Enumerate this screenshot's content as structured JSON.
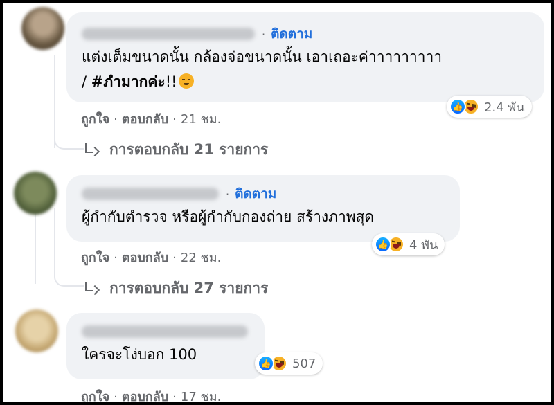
{
  "comments": [
    {
      "follow_label": "ติดตาม",
      "text_line1": "แต่งเต็มขนาดนั้น กล้องจ่อขนาดนั้น เอาเถอะค่าาาาาาาาา",
      "text_line2_prefix": "/ ",
      "text_line2_bold": "#ภำมากค่ะ",
      "text_line2_suffix": "!!",
      "emoji": "pensive-face",
      "reaction_count": "2.4 พัน",
      "like_label": "ถูกใจ",
      "reply_label": "ตอบกลับ",
      "time": "21 ชม.",
      "replies_label": "การตอบกลับ 21 รายการ"
    },
    {
      "follow_label": "ติดตาม",
      "text_line1": "ผู้กำกับตำรวจ หรือผู้กำกับกองถ่าย สร้างภาพสุด",
      "reaction_count": "4 พัน",
      "like_label": "ถูกใจ",
      "reply_label": "ตอบกลับ",
      "time": "22 ชม.",
      "replies_label": "การตอบกลับ 27 รายการ"
    },
    {
      "text_line1": "ใครจะโง่บอก 100",
      "reaction_count": "507",
      "like_label": "ถูกใจ",
      "reply_label": "ตอบกลับ",
      "time": "17 ชม."
    }
  ],
  "separator": "·",
  "reaction_icons": [
    "like-icon",
    "haha-icon"
  ],
  "colors": {
    "bubble_bg": "#f0f2f5",
    "link_blue": "#216fdb",
    "meta_gray": "#65676b",
    "text": "#050505"
  }
}
